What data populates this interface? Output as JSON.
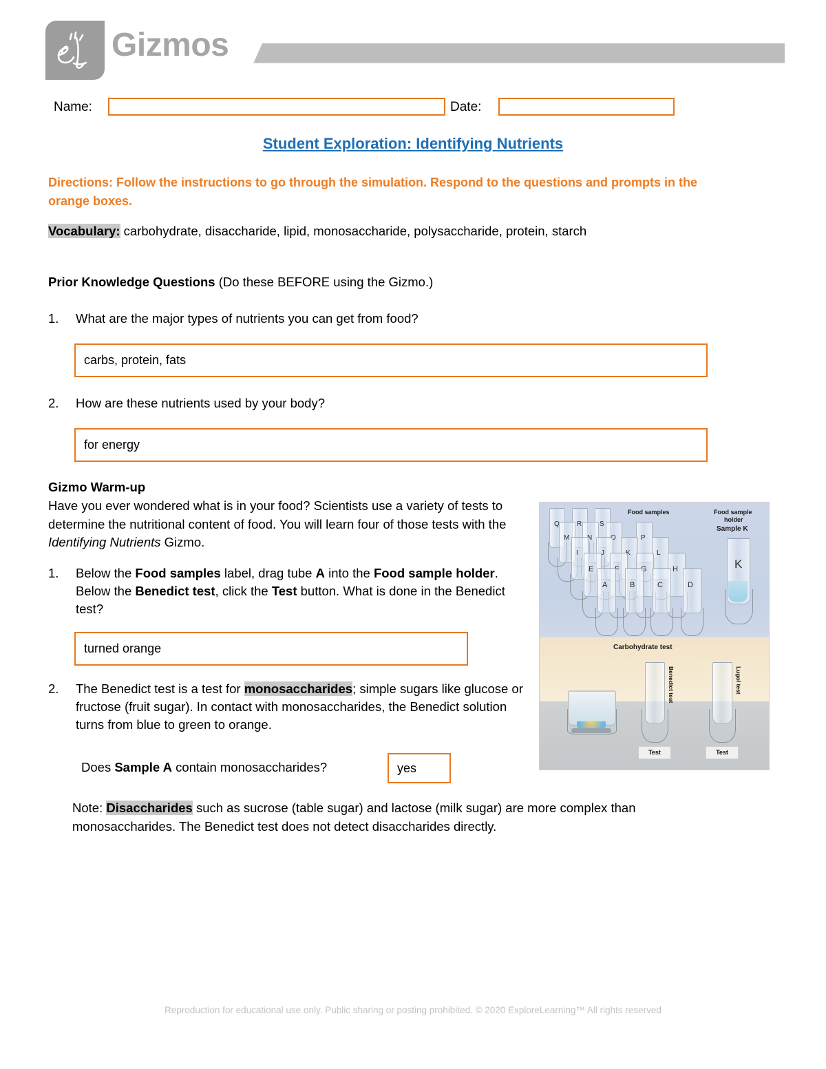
{
  "header": {
    "logo_text": "Gizmos",
    "logo_icon": "el-script-logo"
  },
  "name_row": {
    "name_label": "Name:",
    "name_value": "",
    "date_label": "Date:",
    "date_value": ""
  },
  "title": "Student Exploration: Identifying Nutrients",
  "directions": "Directions: Follow the instructions to go through the simulation. Respond to the questions and prompts in the orange boxes.",
  "vocabulary": {
    "label": "Vocabulary:",
    "terms": " carbohydrate, disaccharide, lipid, monosaccharide, polysaccharide, protein, starch"
  },
  "prior_knowledge": {
    "heading_bold": "Prior Knowledge Questions",
    "heading_rest": " (Do these BEFORE using the Gizmo.)",
    "q1_num": "1.",
    "q1_text": "What are the major types of nutrients you can get from food?",
    "q1_answer": "carbs, protein, fats",
    "q2_num": "2.",
    "q2_text": "How are these nutrients used by your body?",
    "q2_answer": "for energy"
  },
  "warmup": {
    "heading": "Gizmo Warm-up",
    "para_a": "Have you ever wondered what is in your food? Scientists use a variety of tests to determine the nutritional content of food. You will learn four of those tests with the ",
    "para_italic": "Identifying Nutrients",
    "para_b": " Gizmo.",
    "q1_num": "1.",
    "q1_part1": "Below the ",
    "q1_b1": "Food samples",
    "q1_part2": " label, drag tube ",
    "q1_b2": "A",
    "q1_part3": " into the ",
    "q1_b3": "Food sample holder",
    "q1_part4": ". Below the ",
    "q1_b4": "Benedict test",
    "q1_part5": ", click the ",
    "q1_b5": "Test",
    "q1_part6": " button. What is done in the Benedict test?",
    "q1_answer": "turned orange",
    "q2_num": "2.",
    "q2_part1": "The Benedict test is a test for ",
    "q2_hl": "monosaccharides",
    "q2_part2": "; simple sugars like glucose or fructose (fruit sugar). In contact with monosaccharides, the Benedict solution turns from blue to green to orange.",
    "subq_part1": "Does ",
    "subq_bold": "Sample A",
    "subq_part2": " contain monosaccharides?",
    "subq_answer": "yes",
    "note_part1": "Note: ",
    "note_hl": "Disaccharides",
    "note_part2": " such as sucrose (table sugar) and lactose (milk sugar) are more complex than monosaccharides. The Benedict test does not detect disaccharides directly."
  },
  "gizmo_image": {
    "food_samples_label": "Food samples",
    "holder_label_line1": "Food sample",
    "holder_label_line2": "holder",
    "sample_k_label": "Sample K",
    "holder_tube_letter": "K",
    "carb_test_label": "Carbohydrate test",
    "benedict_label": "Benedict test",
    "lugol_label": "Lugol test",
    "benedict_button": "Test",
    "lugol_button": "Test",
    "tube_letters_row1": [
      "A",
      "B",
      "C",
      "D"
    ],
    "tube_letters_row2": [
      "E",
      "F",
      "G",
      "H"
    ],
    "tube_letters_row3": [
      "I",
      "J",
      "K",
      "L"
    ],
    "tube_letters_row4": [
      "M",
      "N",
      "O",
      "P"
    ],
    "tube_letters_row5": [
      "Q",
      "R",
      "S"
    ]
  },
  "footer": "Reproduction for educational use only. Public sharing or posting prohibited. © 2020 ExploreLearning™ All rights reserved",
  "colors": {
    "accent_orange": "#e8791e",
    "directions_orange": "#ee7d22",
    "title_blue": "#1f6fb5",
    "logo_gray": "#9d9d9d",
    "highlight_gray": "#c8c8c8"
  }
}
